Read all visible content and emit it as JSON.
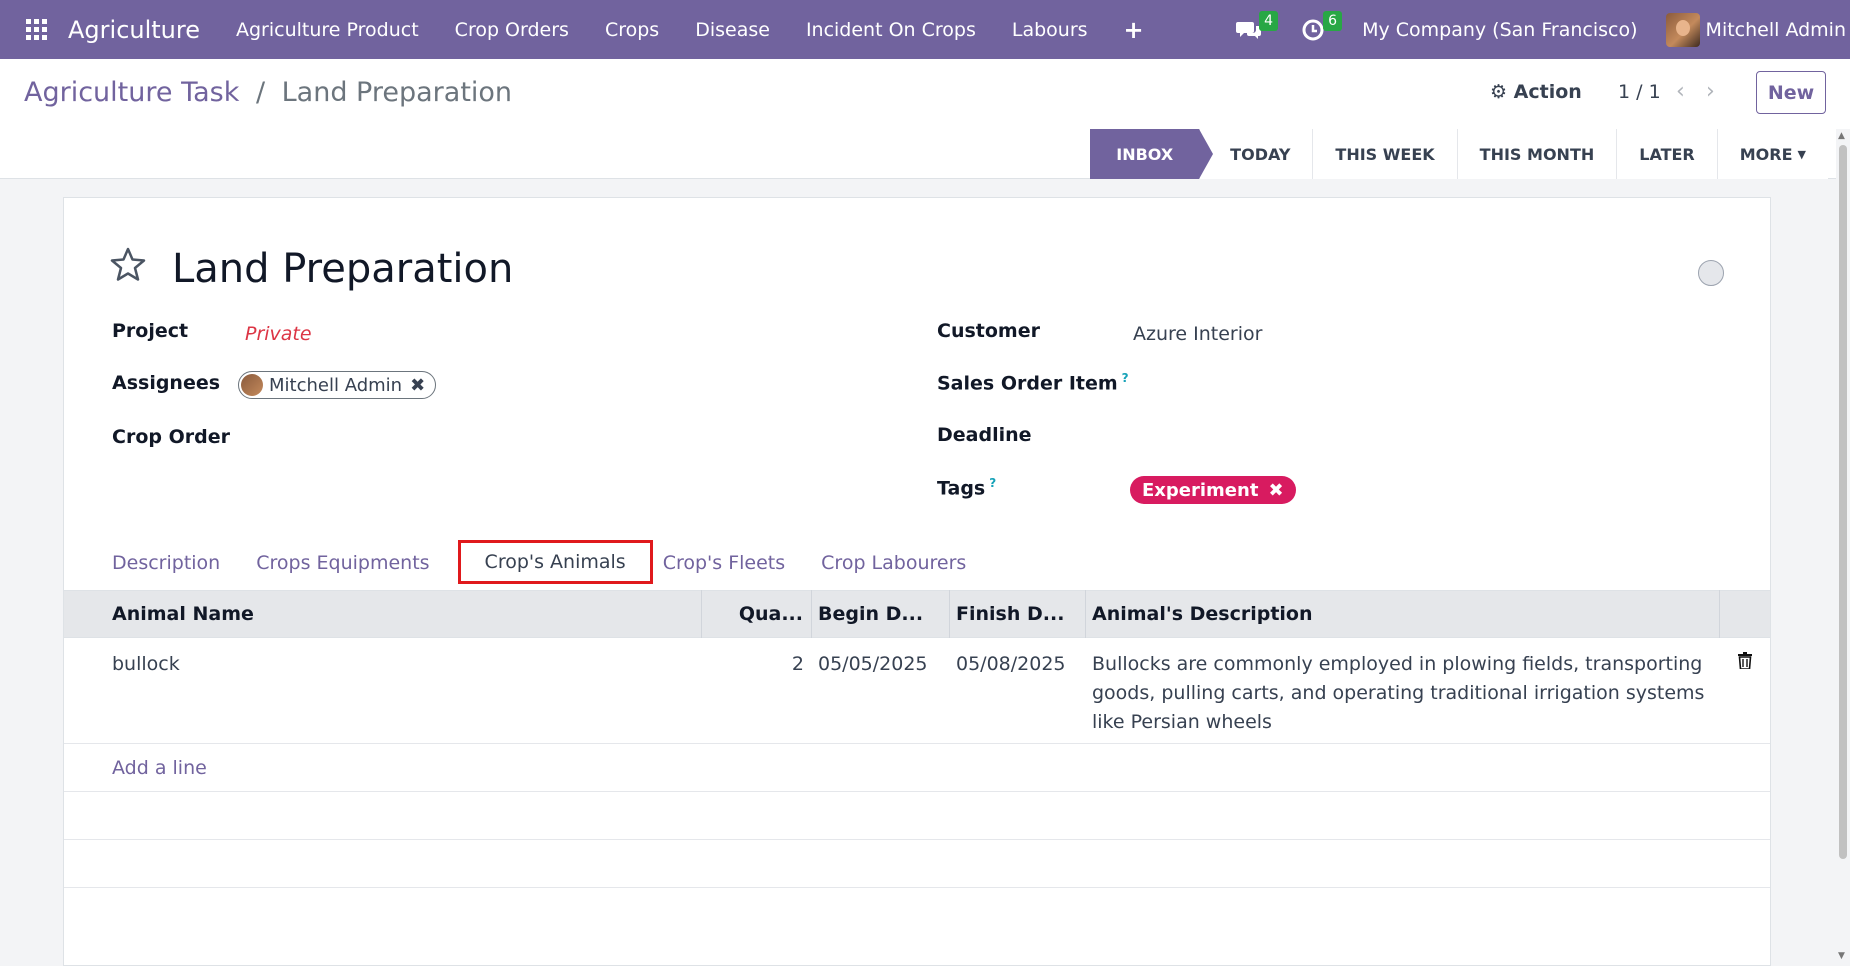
{
  "navbar": {
    "brand": "Agriculture",
    "menu": [
      "Agriculture Product",
      "Crop Orders",
      "Crops",
      "Disease",
      "Incident On Crops",
      "Labours"
    ],
    "plus": "+",
    "messages_count": "4",
    "activities_count": "6",
    "company": "My Company (San Francisco)",
    "user": "Mitchell Admin"
  },
  "control": {
    "breadcrumb_parent": "Agriculture Task",
    "breadcrumb_sep": "/",
    "breadcrumb_current": "Land Preparation",
    "action_label": "Action",
    "pager": "1 / 1",
    "new_label": "New"
  },
  "stages": [
    {
      "label": "INBOX",
      "active": true
    },
    {
      "label": "TODAY",
      "active": false
    },
    {
      "label": "THIS WEEK",
      "active": false
    },
    {
      "label": "THIS MONTH",
      "active": false
    },
    {
      "label": "LATER",
      "active": false
    },
    {
      "label": "MORE",
      "active": false
    }
  ],
  "record": {
    "title": "Land Preparation",
    "fields": {
      "project_label": "Project",
      "project_value": "Private",
      "assignees_label": "Assignees",
      "assignee": "Mitchell Admin",
      "crop_order_label": "Crop Order",
      "customer_label": "Customer",
      "customer_value": "Azure Interior",
      "sales_order_item_label": "Sales Order Item",
      "deadline_label": "Deadline",
      "tags_label": "Tags",
      "tag": "Experiment",
      "help_mark": "?"
    }
  },
  "tabs": [
    {
      "label": "Description",
      "active": false
    },
    {
      "label": "Crops Equipments",
      "active": false
    },
    {
      "label": "Crop's Animals",
      "active": true
    },
    {
      "label": "Crop's Fleets",
      "active": false
    },
    {
      "label": "Crop Labourers",
      "active": false
    }
  ],
  "table": {
    "headers": {
      "name": "Animal Name",
      "qty": "Qua...",
      "begin": "Begin D...",
      "finish": "Finish D...",
      "desc": "Animal's Description"
    },
    "rows": [
      {
        "name": "bullock",
        "qty": "2",
        "begin": "05/05/2025",
        "finish": "05/08/2025",
        "desc": "Bullocks are commonly employed in plowing fields, transporting goods, pulling carts, and operating traditional irrigation systems like Persian wheels"
      }
    ],
    "add_line": "Add a line"
  },
  "colors": {
    "primary": "#71639e",
    "highlight_box": "#e0191c",
    "tag": "#d81b60",
    "badge": "#28a745"
  }
}
